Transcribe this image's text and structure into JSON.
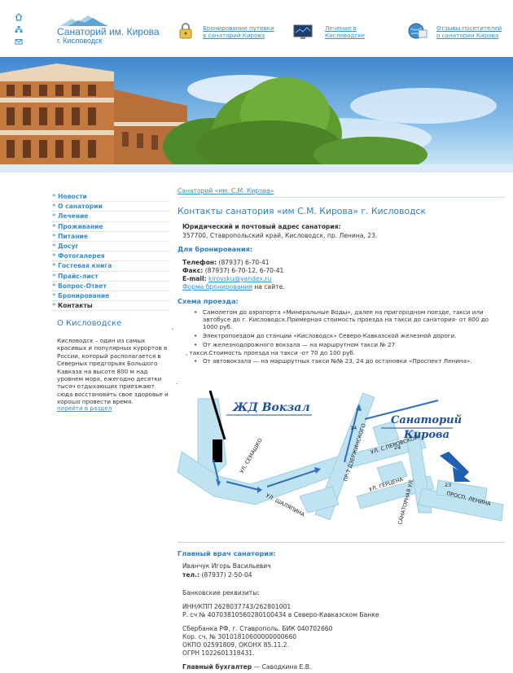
{
  "header": {
    "logo_title": "Санаторий им. Кирова",
    "logo_subtitle": "г. Кисловодск",
    "links": [
      {
        "label_1": "Бронирование путевки",
        "label_2": "в санаторий Кирова",
        "icon": "lock-icon"
      },
      {
        "label_1": "Лечение в",
        "label_2": "Кисловодске",
        "icon": "monitor-icon"
      },
      {
        "label_1": "Отзывы посетителей",
        "label_2": "о санатории Кирова",
        "icon": "globe-icon"
      }
    ],
    "top_icons": [
      "home-icon",
      "sitemap-icon",
      "mail-icon"
    ]
  },
  "menu": {
    "items": [
      "Новости",
      "О санатории",
      "Лечение",
      "Проживание",
      "Питание",
      "Досуг",
      "Фотогалерея",
      "Гостевая книга",
      "Прайс-лист",
      "Вопрос-Ответ",
      "Бронирование",
      "Контакты"
    ],
    "active_index": 11
  },
  "kislovodsk": {
    "title": "О Кисловодске",
    "text": "Кисловодск – один из самых красивых и популярных курортов в России, который располагается в Северных предгорьях Большого Кавказа на высоте 800 м над уровнем моря, ежегодно десятки тысяч отдыхающих приезжают сюда восстановить свое здоровье и хорошо провести время.",
    "more": "перейти в раздел"
  },
  "content": {
    "breadcrumb": "Санаторий «им. С.М. Кирова»",
    "title": "Контакты санатория «им С.М. Кирова» г. Кисловодск",
    "address_label": "Юридический и почтовый адрес санатория:",
    "address": "357700, Ставропольский край, Кисловодск, пр. Ленина, 23.",
    "booking_heading": "Для бронирования:",
    "phone_label": "Телефон:",
    "phone": "(87937) 6-70-41",
    "fax_label": "Факс:",
    "fax": "(87937) 6-70-12, 6-70-41",
    "email_label": "E-mail:",
    "email": "kirovsku@yandex.ru",
    "form_link": "Форма бронирования",
    "form_suffix": "на сайте.",
    "route_heading": "Схема проезда:",
    "route": [
      "Самолетом до аэропорта «Минеральные Воды», далее на пригородном поезде, такси или автобусе до г. Кисловодск.Примерная стоимость проезда на такси до санатория- от 800 до 1000 руб.",
      "Электропоездом до станции «Кисловодск» Северо-Кавказской железной дороги.",
      "От железнодорожного вокзала — на маршрутном такси № 27",
      ", такси.Стоимость проезда на такси -от 70 до 100 руб.",
      "От автовокзала — на маршрутных такси №№ 23, 24 до остановки «Проспект Ленина»."
    ],
    "doctor_heading": "Главный врач санатория:",
    "doctor_name": "Иванчук Игорь Васильевич",
    "doctor_tel_label": "тел.:",
    "doctor_tel": "(87937) 2-50-04",
    "bank_heading": "Банковские реквизиты:",
    "bank_lines_1": [
      "ИНН/КПП 2628037743/262801001",
      "Р. сч № 40703810560280100434 в Северо-Кавказском Банке"
    ],
    "bank_lines_2": [
      "Сбербанка РФ, г. Ставрополь. БИК 040702660",
      "Кор. сч. № 30101810600000000660",
      "ОКПО 02591809, ОКОНХ 85.11.2.",
      "ОГРН 1022601318431."
    ],
    "accountant_label": "Главный бухгалтер",
    "accountant": "— Саводкина Е.В."
  },
  "map": {
    "station": "ЖД Вокзал",
    "sanatorium_1": "Санаторий",
    "sanatorium_2": "Кирова",
    "streets": [
      "УЛ. СЕМАШКО",
      "УЛ. ШАЛЯПИНА",
      "ПР-Т ДЗЕРЖИНСКОГО",
      "УЛ. С.ПЕРОВСКОЙ",
      "УЛ. ГЕРЦЕНА",
      "САНАТОРНАЯ УЛ.",
      "ПРОСП. ЛЕНИНА"
    ],
    "numbers": [
      "14",
      "24",
      "23"
    ]
  },
  "colors": {
    "accent": "#2d7fc4",
    "link": "#3a8fd0",
    "map_road": "#bfe3f0",
    "map_arrow": "#1f5fb4"
  }
}
